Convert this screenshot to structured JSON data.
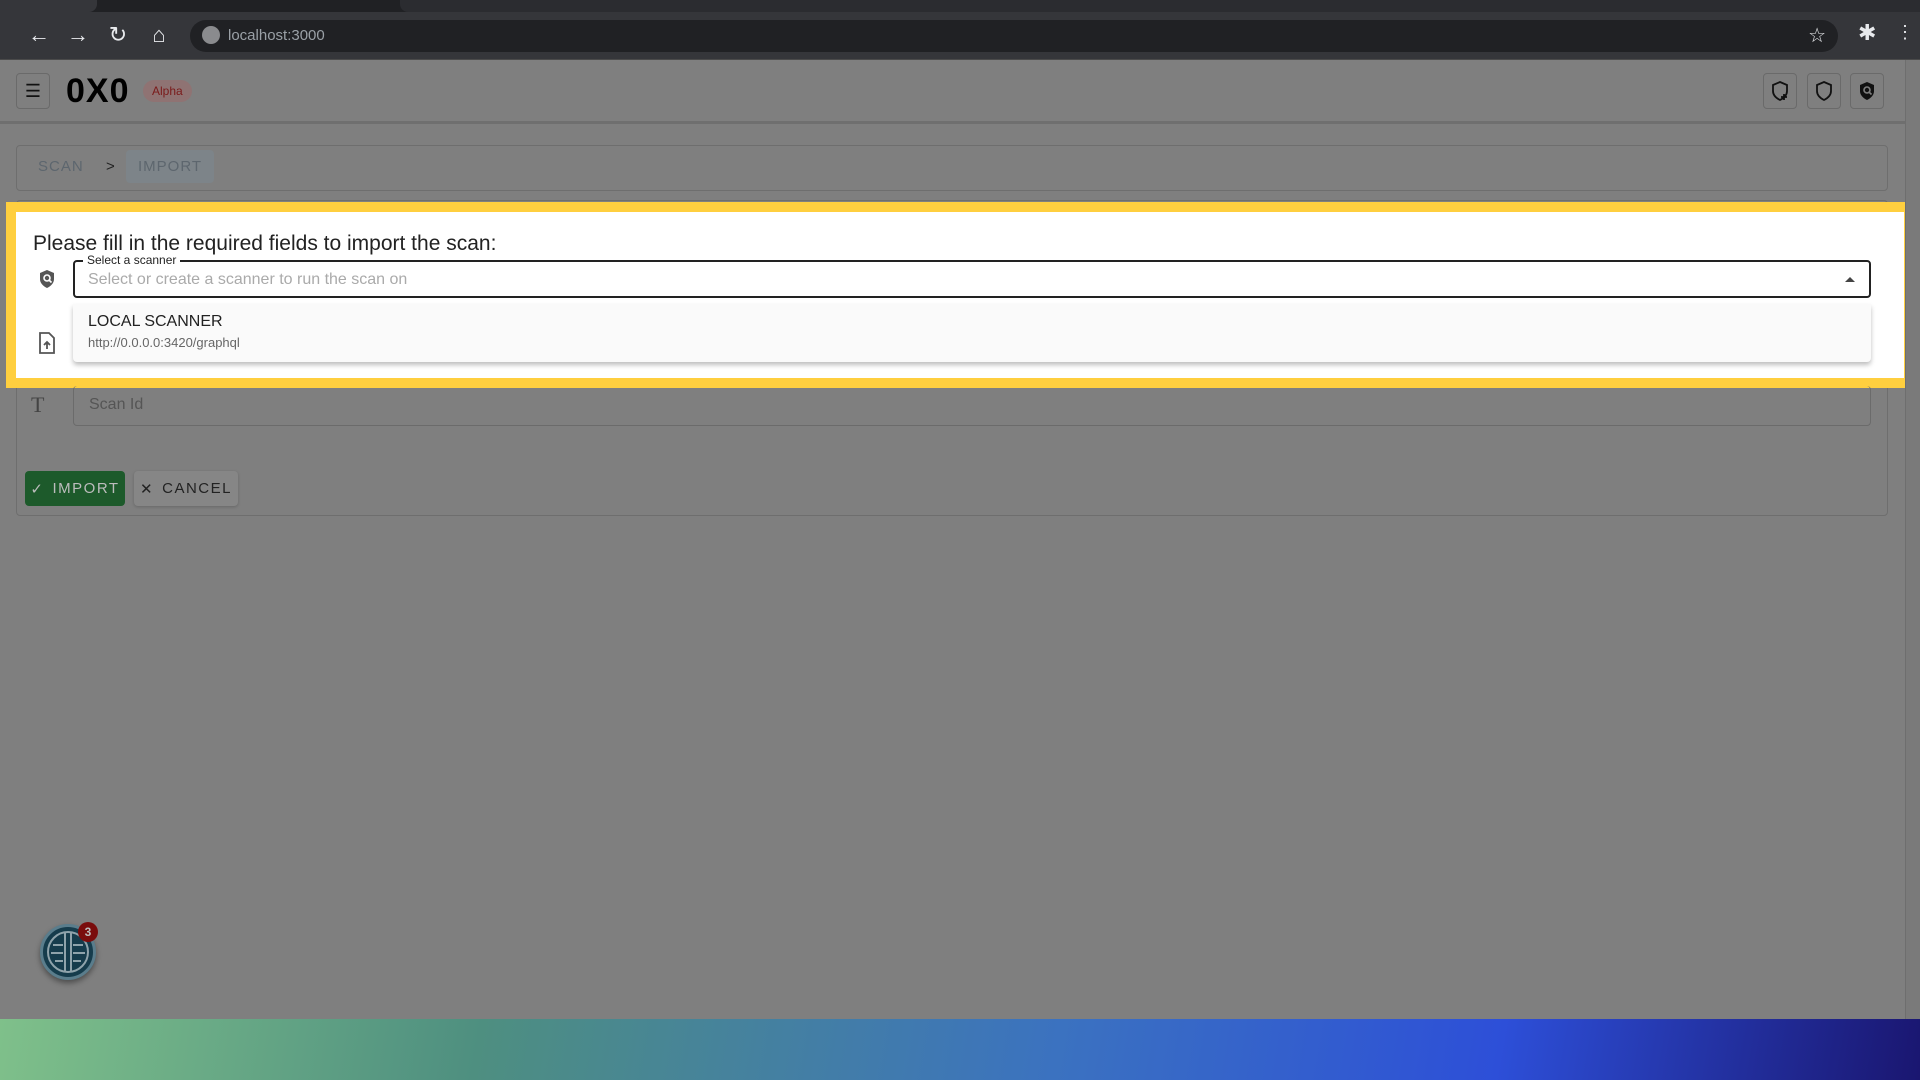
{
  "browser": {
    "url": "localhost:3000",
    "icons": [
      "back-icon",
      "forward-icon",
      "reload-icon",
      "home-icon",
      "star-icon",
      "extensions-icon",
      "menu-icon"
    ]
  },
  "header": {
    "logo": "0X0",
    "badge": "Alpha",
    "icons": [
      "menu-icon",
      "shield-add-icon",
      "shield-icon",
      "shield-search-icon"
    ]
  },
  "breadcrumb": {
    "items": [
      "SCAN",
      "IMPORT"
    ],
    "separator": ">"
  },
  "form": {
    "heading": "Please fill in the required fields to import the scan:",
    "scanner_label": "Select a scanner",
    "scanner_placeholder": "Select or create a scanner to run the scan on",
    "options": [
      {
        "name": "LOCAL SCANNER",
        "url": "http://0.0.0.0:3420/graphql"
      }
    ],
    "scan_id_placeholder": "Scan Id",
    "import_label": "IMPORT",
    "cancel_label": "CANCEL"
  },
  "notifications": {
    "count": "3"
  },
  "colors": {
    "highlight": "#ffcf3f",
    "import_button": "#1d5a2b",
    "badge": "#7a0c0c"
  }
}
